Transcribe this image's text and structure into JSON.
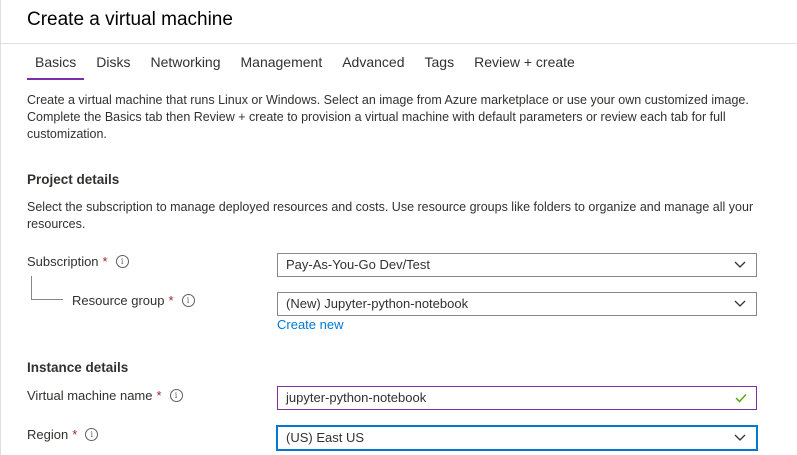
{
  "header": {
    "title": "Create a virtual machine"
  },
  "tabs": [
    {
      "label": "Basics",
      "active": true
    },
    {
      "label": "Disks"
    },
    {
      "label": "Networking"
    },
    {
      "label": "Management"
    },
    {
      "label": "Advanced"
    },
    {
      "label": "Tags"
    },
    {
      "label": "Review + create"
    }
  ],
  "intro": {
    "line1": "Create a virtual machine that runs Linux or Windows. Select an image from Azure marketplace or use your own customized image.",
    "line2": "Complete the Basics tab then Review + create to provision a virtual machine with default parameters or review each tab for full customization."
  },
  "project": {
    "title": "Project details",
    "description": "Select the subscription to manage deployed resources and costs. Use resource groups like folders to organize and manage all your resources.",
    "subscription": {
      "label": "Subscription",
      "required": "*",
      "value": "Pay-As-You-Go Dev/Test"
    },
    "resource_group": {
      "label": "Resource group",
      "required": "*",
      "value": "(New) Jupyter-python-notebook",
      "create_new": "Create new"
    }
  },
  "instance": {
    "title": "Instance details",
    "vm_name": {
      "label": "Virtual machine name",
      "required": "*",
      "value": "jupyter-python-notebook"
    },
    "region": {
      "label": "Region",
      "required": "*",
      "value": "(US) East US"
    }
  },
  "icons": {
    "info": "i"
  },
  "colors": {
    "accent": "#7a2fa5",
    "link": "#0078d4",
    "required": "#a4262c",
    "valid_check": "#57a300"
  }
}
